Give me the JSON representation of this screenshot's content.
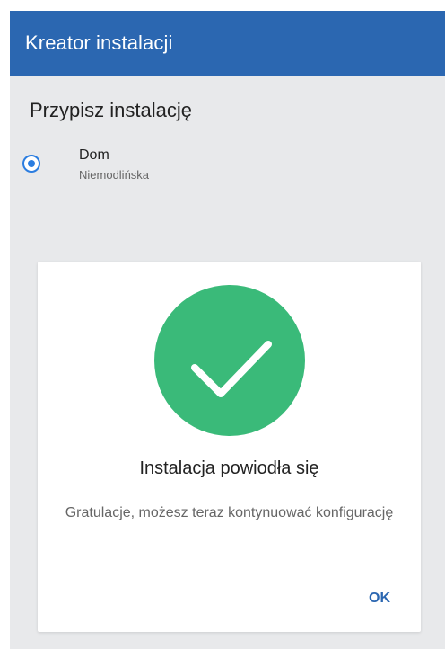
{
  "header": {
    "title": "Kreator instalacji"
  },
  "section": {
    "title": "Przypisz instalację"
  },
  "installation_option": {
    "name": "Dom",
    "address": "Niemodlińska",
    "selected": true
  },
  "dialog": {
    "icon": "checkmark-icon",
    "title": "Instalacja powiodła się",
    "message": "Gratulacje, możesz teraz kontynuować konfigurację",
    "ok_label": "OK"
  },
  "colors": {
    "header_bg": "#2b67b1",
    "success_green": "#3aba79",
    "radio_blue": "#2b7de0",
    "background": "#e8e9eb"
  }
}
